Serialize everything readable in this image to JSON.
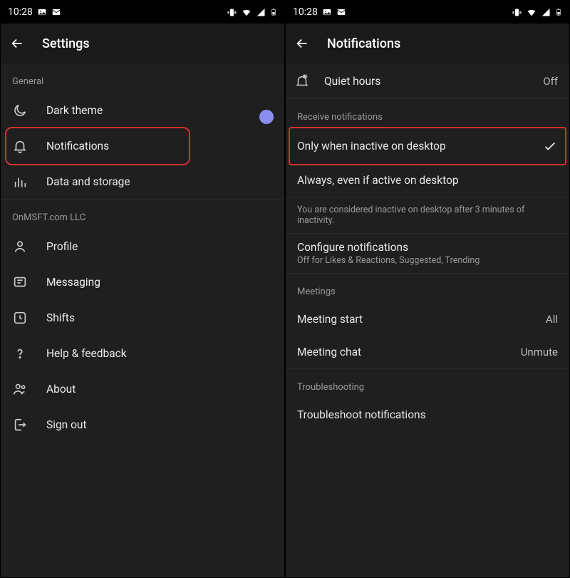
{
  "status": {
    "time": "10:28",
    "icons_left": [
      "image-icon",
      "mail-icon"
    ],
    "icons_right": [
      "vibrate-icon",
      "wifi-icon",
      "signal-icon",
      "battery-icon"
    ]
  },
  "left": {
    "title": "Settings",
    "sections": [
      {
        "header": "General",
        "items": [
          {
            "icon": "moon",
            "label": "Dark theme",
            "toggle": true
          },
          {
            "icon": "bell",
            "label": "Notifications",
            "highlight": true
          },
          {
            "icon": "bars",
            "label": "Data and storage"
          }
        ]
      },
      {
        "header": "OnMSFT.com LLC",
        "items": [
          {
            "icon": "person",
            "label": "Profile"
          },
          {
            "icon": "message",
            "label": "Messaging"
          },
          {
            "icon": "clock",
            "label": "Shifts"
          },
          {
            "icon": "question",
            "label": "Help & feedback"
          },
          {
            "icon": "teams",
            "label": "About"
          },
          {
            "icon": "signout",
            "label": "Sign out"
          }
        ]
      }
    ]
  },
  "right": {
    "title": "Notifications",
    "quiet_hours": {
      "label": "Quiet hours",
      "value": "Off"
    },
    "receive_header": "Receive notifications",
    "options": [
      {
        "label": "Only when inactive on desktop",
        "selected": true,
        "highlight": true
      },
      {
        "label": "Always, even if active on desktop",
        "selected": false
      }
    ],
    "inactive_note": "You are considered inactive on desktop after 3 minutes of inactivity.",
    "configure": {
      "title": "Configure notifications",
      "subtitle": "Off for Likes & Reactions, Suggested, Trending"
    },
    "meetings_header": "Meetings",
    "meetings": [
      {
        "label": "Meeting start",
        "value": "All"
      },
      {
        "label": "Meeting chat",
        "value": "Unmute"
      }
    ],
    "troubleshoot_header": "Troubleshooting",
    "troubleshoot_label": "Troubleshoot notifications"
  }
}
